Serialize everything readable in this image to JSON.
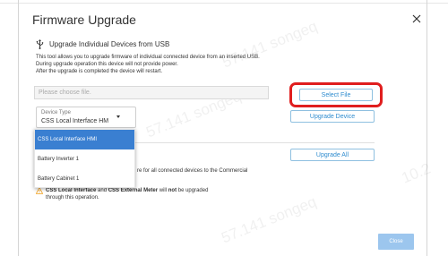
{
  "dialog": {
    "title": "Firmware Upgrade",
    "close_icon": "close-icon"
  },
  "individual": {
    "icon": "usb-icon",
    "heading": "Upgrade Individual Devices from USB",
    "desc_lines": [
      "This tool allows you to upgrade firmware of individual connected device from an inserted USB.",
      "During upgrade operation this device will not provide power.",
      "After the upgrade is completed the device will restart."
    ],
    "file_placeholder": "Please choose file.",
    "select_file_label": "Select File",
    "device_type_label": "Device Type",
    "device_type_value": "CSS Local Interface HM",
    "upgrade_device_label": "Upgrade Device",
    "dropdown_options": [
      "CSS Local Interface HMI",
      "Battery Inverter 1",
      "Battery Cabinet 1"
    ],
    "dropdown_selected_index": 0
  },
  "all": {
    "upgrade_all_label": "Upgrade All",
    "desc": "re for all connected devices to the Commercial",
    "warning_bold_1": "CSS Local Interface",
    "warning_mid_1": " and ",
    "warning_bold_2": "CSS External Meter",
    "warning_mid_2": " will ",
    "warning_bold_3": "not",
    "warning_end": " be upgraded",
    "warning_line2": "through this operation."
  },
  "footer": {
    "close_label": "Close"
  },
  "watermarks": [
    "57.141 songeq",
    "10.2",
    "57.141 songeq",
    "57.141 songeq"
  ],
  "colors": {
    "accent": "#2f8ccf",
    "highlight_border": "#e01e1e",
    "dropdown_selected": "#3a7fd1",
    "close_button": "#9cc6ee",
    "warning": "#f0a01e"
  }
}
